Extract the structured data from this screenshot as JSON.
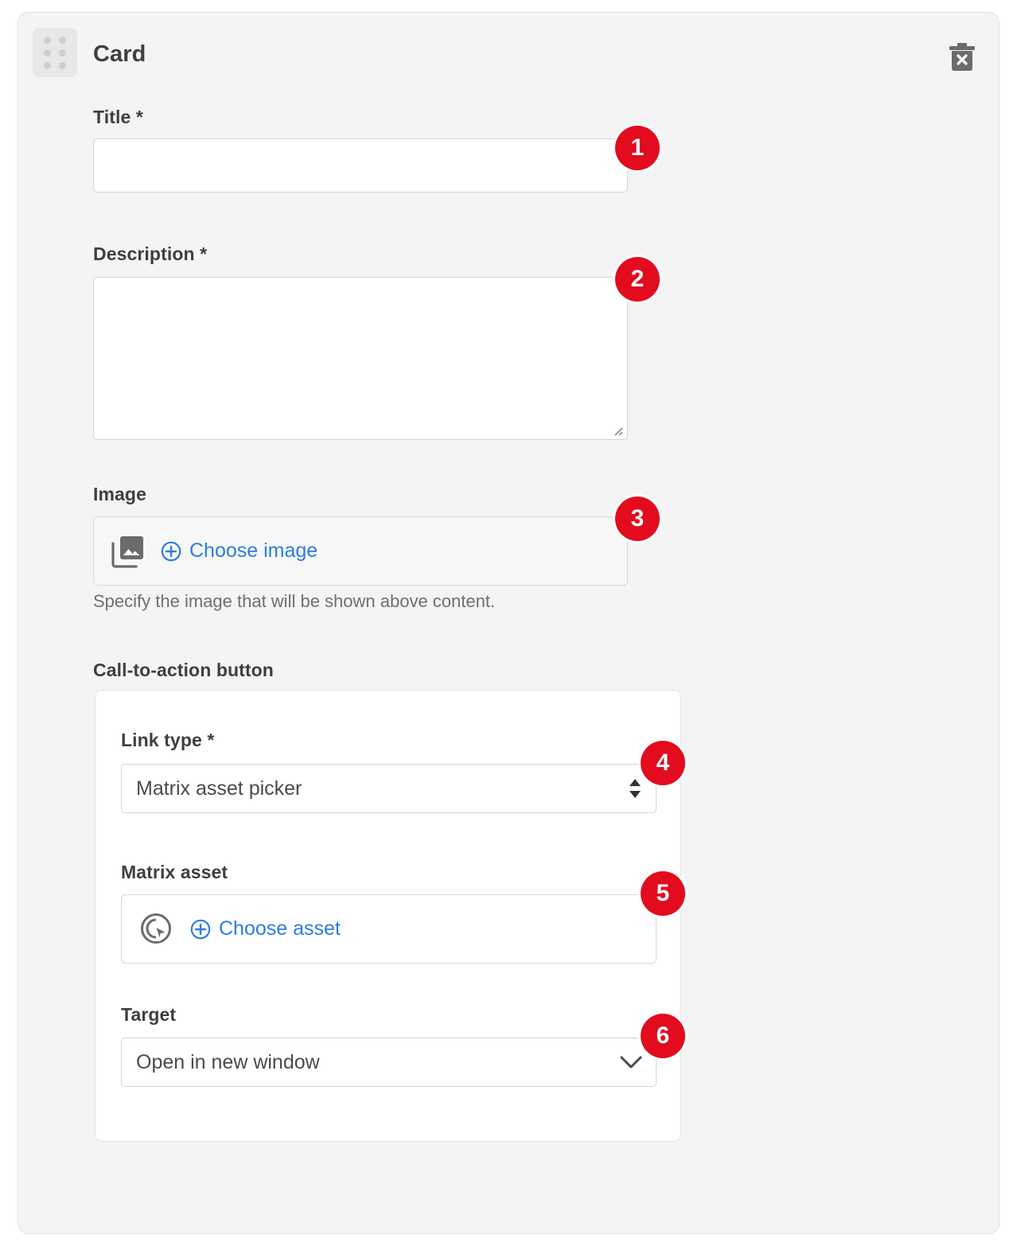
{
  "card": {
    "title": "Card",
    "drag_handle_icon": "drag-grip-icon",
    "delete_icon": "trash-x-icon"
  },
  "fields": {
    "title": {
      "label": "Title *",
      "value": "",
      "placeholder": ""
    },
    "description": {
      "label": "Description *",
      "value": "",
      "placeholder": ""
    },
    "image": {
      "label": "Image",
      "icon": "image-stack-icon",
      "plus_icon": "plus-circle-icon",
      "action_label": "Choose image",
      "help": "Specify the image that will be shown above content."
    }
  },
  "cta": {
    "section_label": "Call-to-action button",
    "link_type": {
      "label": "Link type *",
      "value": "Matrix asset picker",
      "arrow_icon": "sort-updown-icon"
    },
    "matrix_asset": {
      "label": "Matrix asset",
      "icon": "asset-target-cursor-icon",
      "plus_icon": "plus-circle-icon",
      "action_label": "Choose asset"
    },
    "target": {
      "label": "Target",
      "value": "Open in new window",
      "arrow_icon": "chevron-down-icon"
    }
  },
  "badges": [
    {
      "number": "1"
    },
    {
      "number": "2"
    },
    {
      "number": "3"
    },
    {
      "number": "4"
    },
    {
      "number": "5"
    },
    {
      "number": "6"
    }
  ],
  "colors": {
    "badge_red": "#e30b1e",
    "link_blue": "#2b7de0",
    "card_bg": "#f4f4f4",
    "text": "#3f3f3f"
  }
}
